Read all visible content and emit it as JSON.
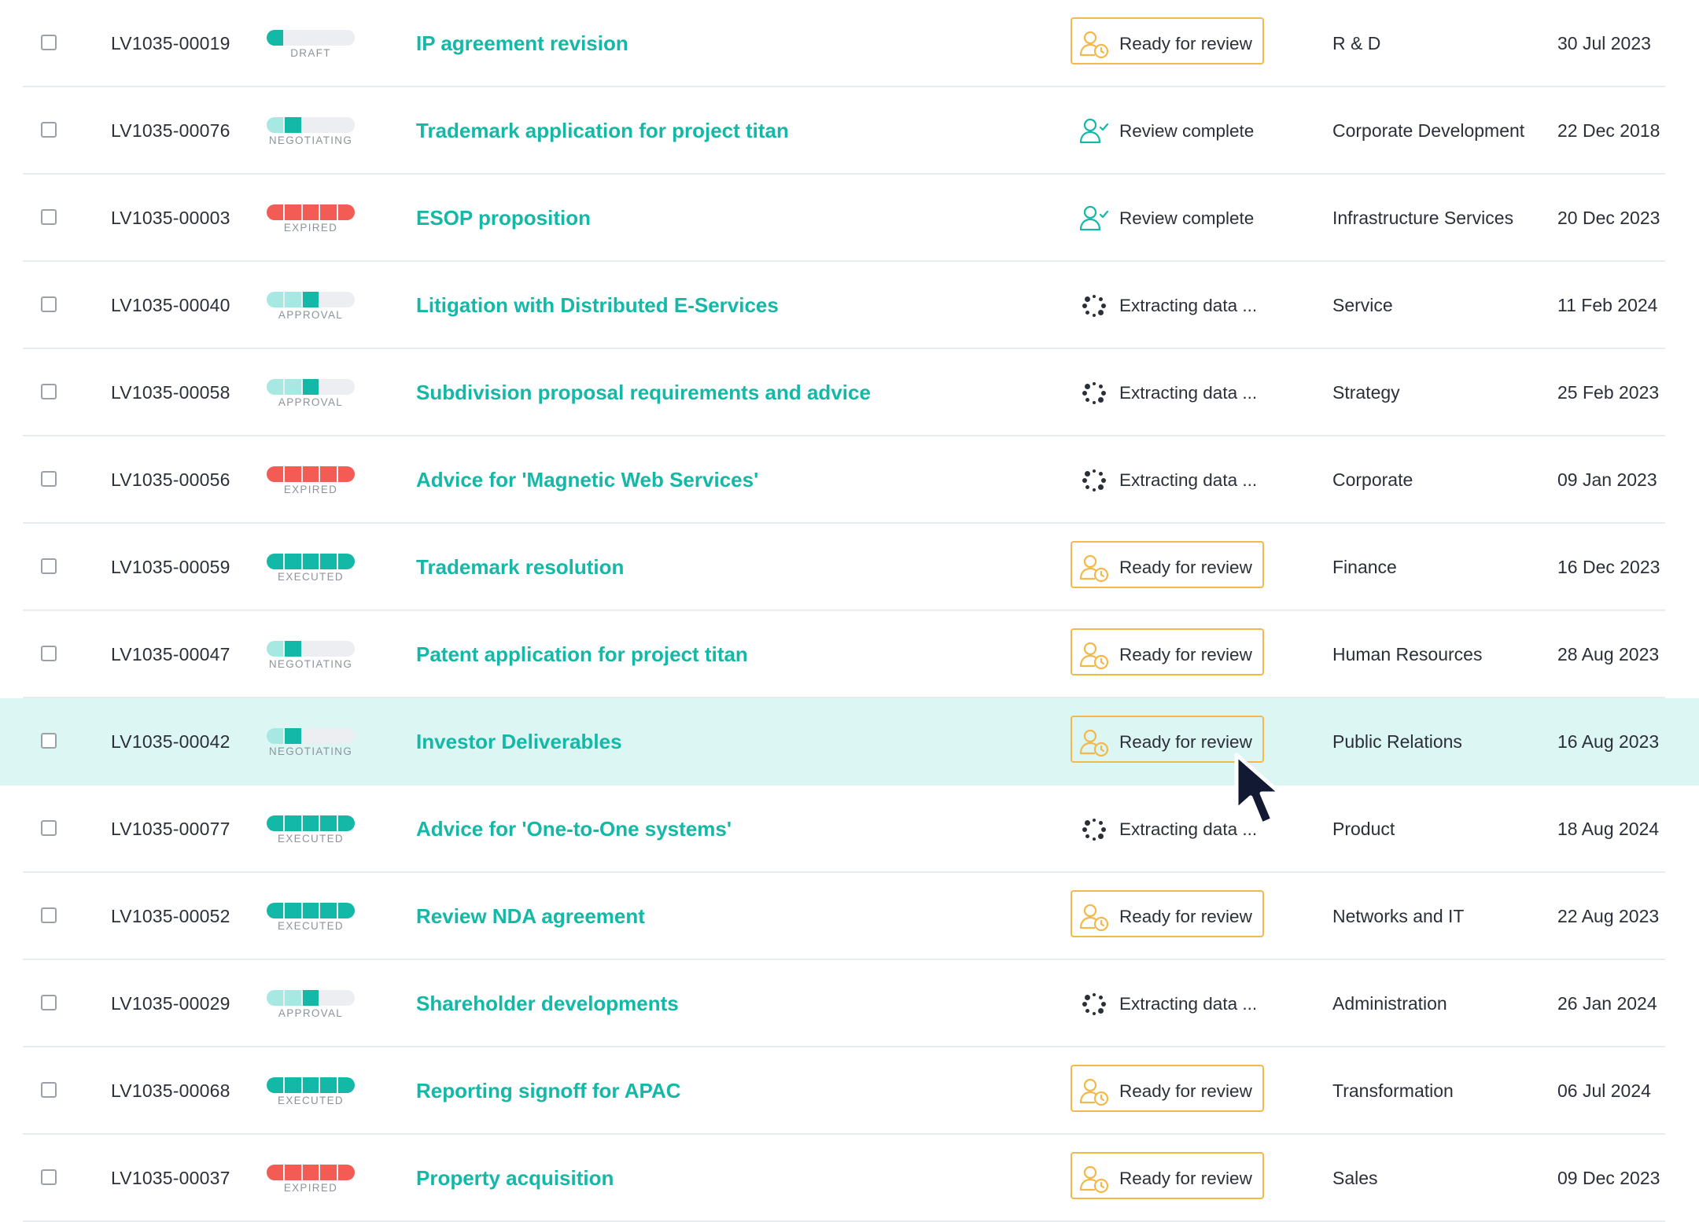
{
  "colors": {
    "accent": "#14b8a6",
    "accent_light": "#a7e9e2",
    "expired": "#f25c54",
    "empty": "#eceef1",
    "review_orange": "#f2b84b",
    "selected_row": "#dcf6f3"
  },
  "rows": [
    {
      "id": "LV1035-00019",
      "stage": "DRAFT",
      "stage_level": 1,
      "title": "IP agreement revision",
      "status": "Ready for review",
      "status_icon": "user-clock-icon",
      "department": "R & D",
      "date": "30 Jul 2023"
    },
    {
      "id": "LV1035-00076",
      "stage": "NEGOTIATING",
      "stage_level": 2,
      "title": "Trademark application for project titan",
      "status": "Review complete",
      "status_icon": "user-check-icon",
      "department": "Corporate Development",
      "date": "22 Dec 2018"
    },
    {
      "id": "LV1035-00003",
      "stage": "EXPIRED",
      "stage_level": 5,
      "title": "ESOP proposition",
      "status": "Review complete",
      "status_icon": "user-check-icon",
      "department": "Infrastructure Services",
      "date": "20 Dec 2023"
    },
    {
      "id": "LV1035-00040",
      "stage": "APPROVAL",
      "stage_level": 3,
      "title": "Litigation with Distributed E-Services",
      "status": "Extracting data ...",
      "status_icon": "loading-spinner-icon",
      "department": "Service",
      "date": "11 Feb 2024"
    },
    {
      "id": "LV1035-00058",
      "stage": "APPROVAL",
      "stage_level": 3,
      "title": "Subdivision proposal requirements and advice",
      "status": "Extracting data ...",
      "status_icon": "loading-spinner-icon",
      "department": "Strategy",
      "date": "25 Feb 2023"
    },
    {
      "id": "LV1035-00056",
      "stage": "EXPIRED",
      "stage_level": 5,
      "title": "Advice for 'Magnetic Web Services'",
      "status": "Extracting data ...",
      "status_icon": "loading-spinner-icon",
      "department": "Corporate",
      "date": "09 Jan 2023"
    },
    {
      "id": "LV1035-00059",
      "stage": "EXECUTED",
      "stage_level": 5,
      "title": "Trademark resolution",
      "status": "Ready for review",
      "status_icon": "user-clock-icon",
      "department": "Finance",
      "date": "16 Dec 2023"
    },
    {
      "id": "LV1035-00047",
      "stage": "NEGOTIATING",
      "stage_level": 2,
      "title": "Patent application for project titan",
      "status": "Ready for review",
      "status_icon": "user-clock-icon",
      "department": "Human Resources",
      "date": "28 Aug 2023"
    },
    {
      "id": "LV1035-00042",
      "stage": "NEGOTIATING",
      "stage_level": 2,
      "title": "Investor Deliverables",
      "status": "Ready for review",
      "status_icon": "user-clock-icon",
      "department": "Public Relations",
      "date": "16 Aug 2023",
      "selected": true
    },
    {
      "id": "LV1035-00077",
      "stage": "EXECUTED",
      "stage_level": 5,
      "title": "Advice for 'One-to-One systems'",
      "status": "Extracting data ...",
      "status_icon": "loading-spinner-icon",
      "department": "Product",
      "date": "18 Aug 2024"
    },
    {
      "id": "LV1035-00052",
      "stage": "EXECUTED",
      "stage_level": 5,
      "title": "Review NDA agreement",
      "status": "Ready for review",
      "status_icon": "user-clock-icon",
      "department": "Networks and IT",
      "date": "22 Aug 2023"
    },
    {
      "id": "LV1035-00029",
      "stage": "APPROVAL",
      "stage_level": 3,
      "title": "Shareholder developments",
      "status": "Extracting data ...",
      "status_icon": "loading-spinner-icon",
      "department": "Administration",
      "date": "26 Jan 2024"
    },
    {
      "id": "LV1035-00068",
      "stage": "EXECUTED",
      "stage_level": 5,
      "title": "Reporting signoff for APAC",
      "status": "Ready for review",
      "status_icon": "user-clock-icon",
      "department": "Transformation",
      "date": "06 Jul 2024"
    },
    {
      "id": "LV1035-00037",
      "stage": "EXPIRED",
      "stage_level": 5,
      "title": "Property acquisition",
      "status": "Ready for review",
      "status_icon": "user-clock-icon",
      "department": "Sales",
      "date": "09 Dec 2023"
    }
  ],
  "cursor_icon": "mouse-pointer-icon"
}
